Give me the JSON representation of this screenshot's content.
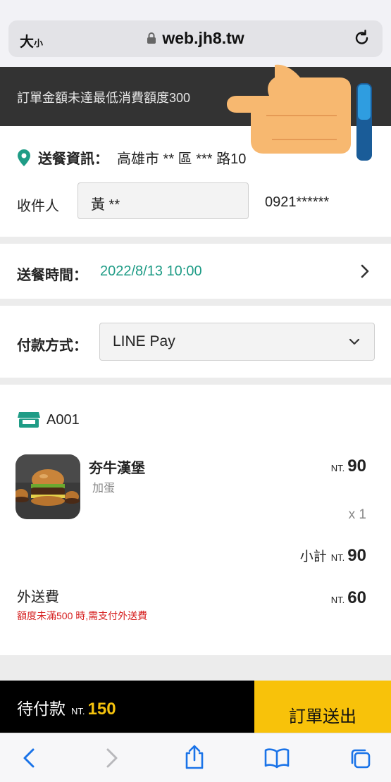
{
  "browser": {
    "text_size_label": "大",
    "text_size_small": "小",
    "url": "web.jh8.tw"
  },
  "toast": {
    "message": "訂單金額未達最低消費額度300"
  },
  "delivery": {
    "label": "送餐資訊：",
    "address": "高雄市 ** 區  *** 路10",
    "receiver_label": "收件人",
    "receiver_name": "黃 **",
    "phone": "0921******"
  },
  "time": {
    "label": "送餐時間：",
    "value": "2022/8/13 10:00"
  },
  "payment": {
    "label": "付款方式：",
    "selected": "LINE Pay"
  },
  "order": {
    "store_id": "A001",
    "item": {
      "name": "夯牛漢堡",
      "option": "加蛋",
      "currency": "NT.",
      "price": "90",
      "qty": "x 1"
    },
    "subtotal_label": "小計",
    "subtotal_currency": "NT.",
    "subtotal": "90",
    "fee_label": "外送費",
    "fee_currency": "NT.",
    "fee": "60",
    "fee_note": "額度未滿500 時,需支付外送費"
  },
  "footer": {
    "pending_label": "待付款",
    "currency": "NT.",
    "total": "150",
    "submit_label": "訂單送出"
  },
  "colors": {
    "accent_teal": "#1f9c86",
    "accent_yellow": "#f8c20a",
    "warning_red": "#d61f1f"
  }
}
